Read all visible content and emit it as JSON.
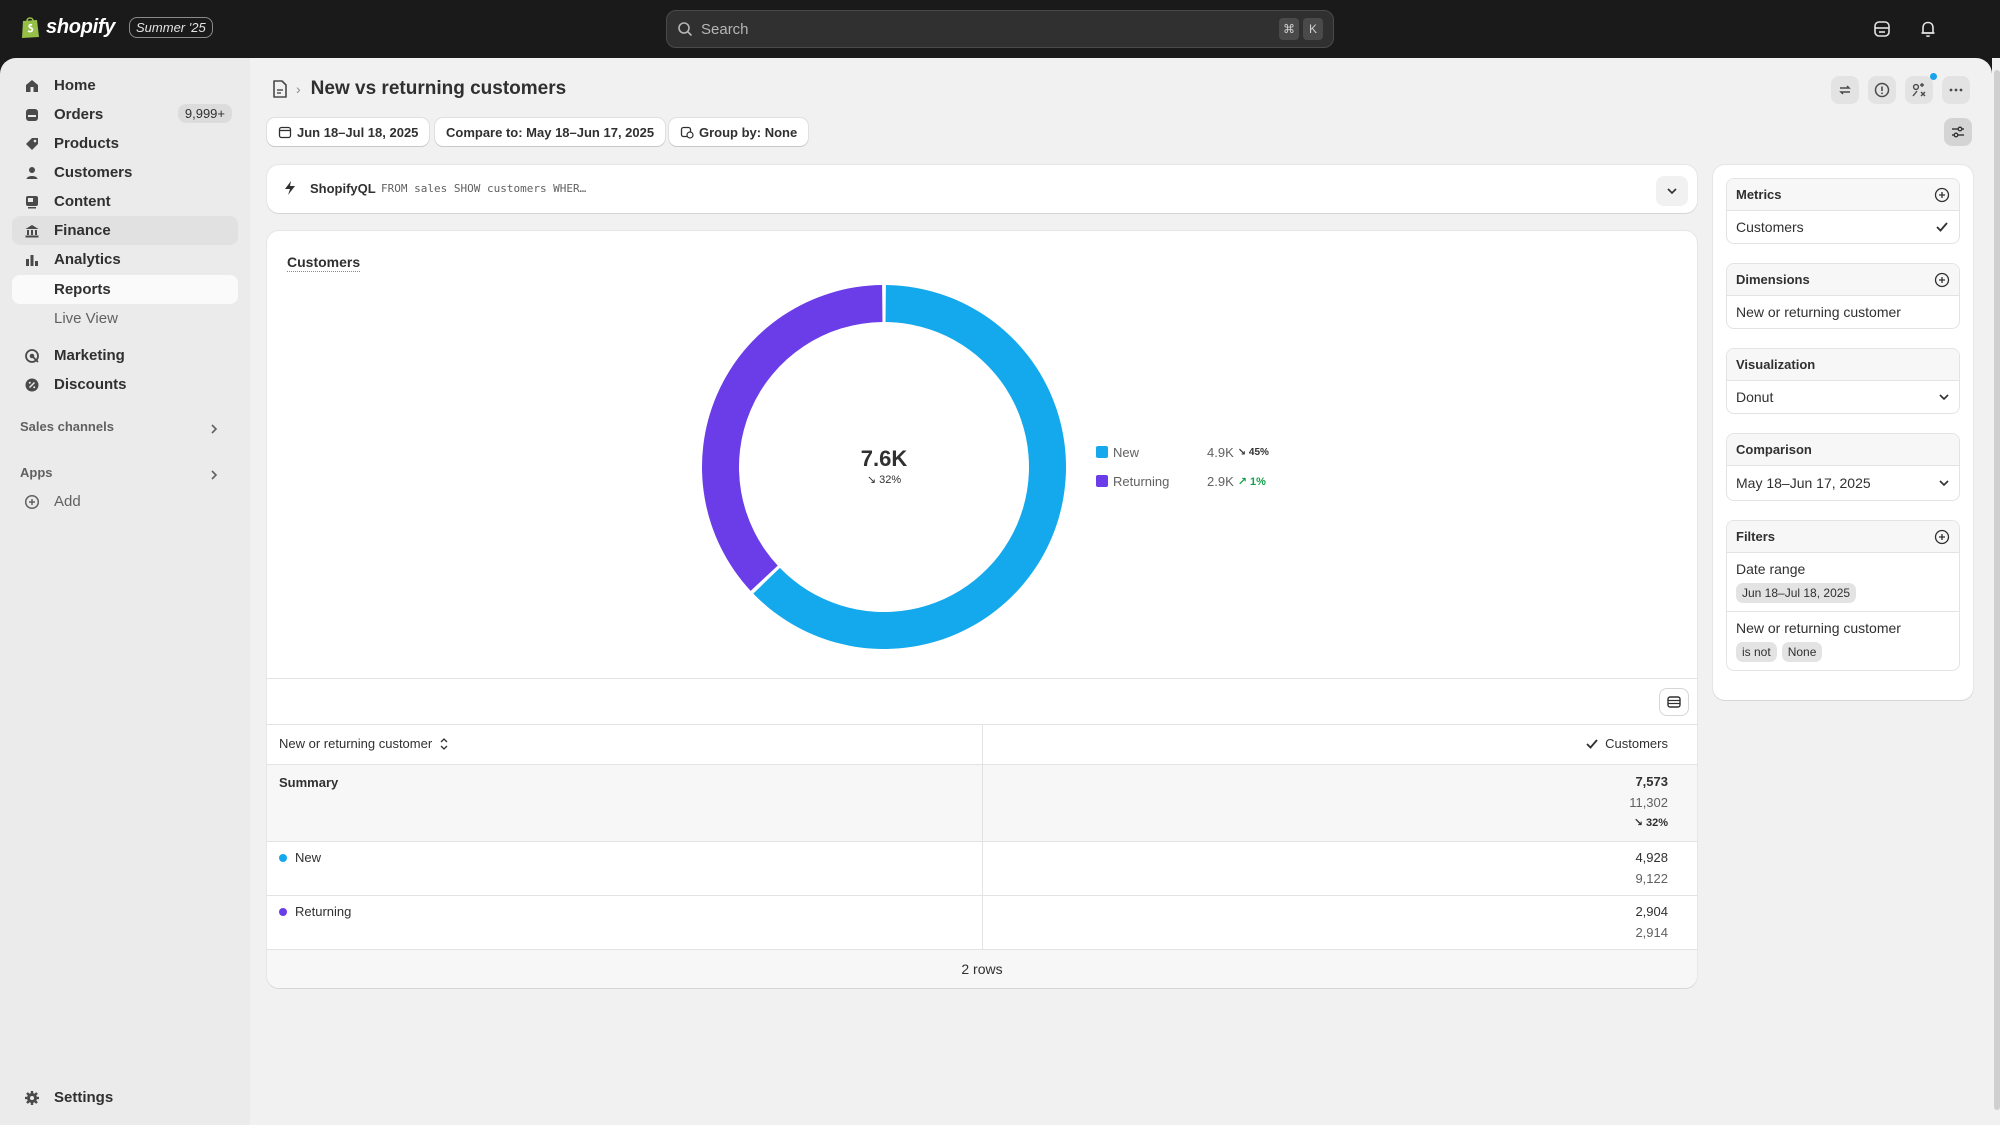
{
  "topbar": {
    "brand": "shopify",
    "edition": "Summer '25",
    "search_placeholder": "Search",
    "shortcut_keys": [
      "⌘",
      "K"
    ]
  },
  "sidebar": {
    "items": [
      {
        "label": "Home",
        "icon": "home-icon"
      },
      {
        "label": "Orders",
        "icon": "orders-icon",
        "badge": "9,999+"
      },
      {
        "label": "Products",
        "icon": "tag-icon"
      },
      {
        "label": "Customers",
        "icon": "person-icon"
      },
      {
        "label": "Content",
        "icon": "content-icon"
      },
      {
        "label": "Finance",
        "icon": "bank-icon"
      },
      {
        "label": "Analytics",
        "icon": "chart-icon"
      },
      {
        "label": "Reports"
      },
      {
        "label": "Live View"
      },
      {
        "label": "Marketing",
        "icon": "target-icon"
      },
      {
        "label": "Discounts",
        "icon": "discount-icon"
      }
    ],
    "sales_channels": "Sales channels",
    "apps": "Apps",
    "add": "Add",
    "settings": "Settings"
  },
  "page": {
    "title": "New vs returning customers"
  },
  "toolbar": {
    "date_range": "Jun 18–Jul 18, 2025",
    "compare": "Compare to: May 18–Jun 17, 2025",
    "group_by": "Group by: None"
  },
  "query": {
    "label": "ShopifyQL",
    "code": "FROM sales SHOW customers WHER…"
  },
  "chart_data": {
    "type": "pie",
    "title": "Customers",
    "categories": [
      "New",
      "Returning"
    ],
    "values": [
      4928,
      2904
    ],
    "colors": [
      "#13a9ec",
      "#6a3de8"
    ],
    "total_label": "7.6K",
    "total_change": "32%",
    "legend": [
      {
        "name": "New",
        "value": "4.9K",
        "change": "45%",
        "direction": "down"
      },
      {
        "name": "Returning",
        "value": "2.9K",
        "change": "1%",
        "direction": "up"
      }
    ]
  },
  "table": {
    "headers": [
      "New or returning customer",
      "Customers"
    ],
    "summary": {
      "label": "Summary",
      "current": "7,573",
      "previous": "11,302",
      "change": "32%"
    },
    "rows": [
      {
        "label": "New",
        "current": "4,928",
        "previous": "9,122"
      },
      {
        "label": "Returning",
        "current": "2,904",
        "previous": "2,914"
      }
    ],
    "footer": "2 rows"
  },
  "panel": {
    "metrics_title": "Metrics",
    "metric": "Customers",
    "dimensions_title": "Dimensions",
    "dimension": "New or returning customer",
    "visualization_title": "Visualization",
    "visualization": "Donut",
    "comparison_title": "Comparison",
    "comparison": "May 18–Jun 17, 2025",
    "filters_title": "Filters",
    "filter1_label": "Date range",
    "filter1_value": "Jun 18–Jul 18, 2025",
    "filter2_label": "New or returning customer",
    "filter2_op": "is not",
    "filter2_value": "None"
  },
  "colors": {
    "new": "#13a9ec",
    "returning": "#6a3de8",
    "positive": "#14a04a"
  }
}
